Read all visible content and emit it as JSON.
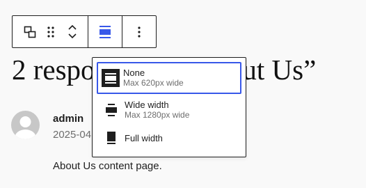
{
  "toolbar": {
    "buttons": [
      "transform-icon",
      "drag-icon",
      "move-up-icon",
      "move-down-icon",
      "align-none-icon",
      "more-options-icon"
    ],
    "accent_color": "#3858e9"
  },
  "post": {
    "heading": "2 responses to “About Us”"
  },
  "comment": {
    "author": "admin",
    "date": "2025-04",
    "content": "About Us content page."
  },
  "alignment_menu": {
    "options": [
      {
        "label": "None",
        "description": "Max 620px wide",
        "selected": true
      },
      {
        "label": "Wide width",
        "description": "Max 1280px wide",
        "selected": false
      },
      {
        "label": "Full width",
        "description": "",
        "selected": false
      }
    ]
  }
}
